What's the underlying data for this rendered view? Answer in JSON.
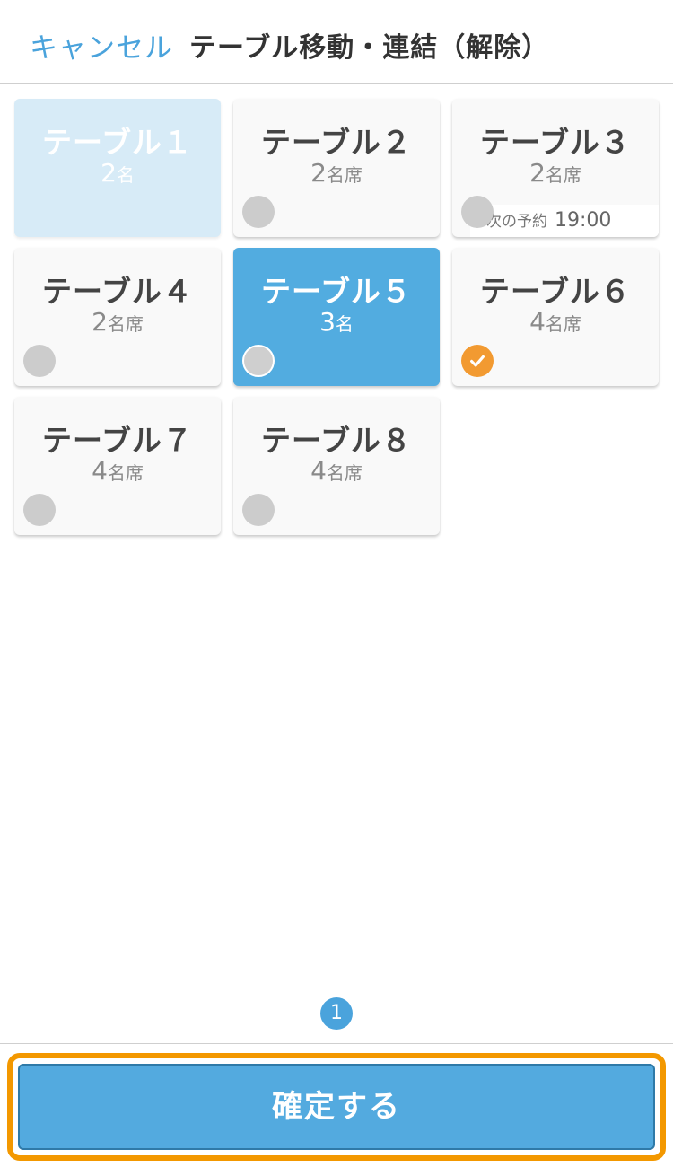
{
  "header": {
    "cancel_label": "キャンセル",
    "title": "テーブル移動・連結（解除）"
  },
  "tables": [
    {
      "name": "テーブル１",
      "seats_num": "2",
      "seats_unit": "名",
      "state": "disabled"
    },
    {
      "name": "テーブル２",
      "seats_num": "2",
      "seats_unit": "名席",
      "state": "available"
    },
    {
      "name": "テーブル３",
      "seats_num": "2",
      "seats_unit": "名席",
      "state": "available",
      "next_reservation_label": "次の予約",
      "next_reservation_time": "19:00"
    },
    {
      "name": "テーブル４",
      "seats_num": "2",
      "seats_unit": "名席",
      "state": "available"
    },
    {
      "name": "テーブル５",
      "seats_num": "3",
      "seats_unit": "名",
      "state": "current"
    },
    {
      "name": "テーブル６",
      "seats_num": "4",
      "seats_unit": "名席",
      "state": "checked"
    },
    {
      "name": "テーブル７",
      "seats_num": "4",
      "seats_unit": "名席",
      "state": "available"
    },
    {
      "name": "テーブル８",
      "seats_num": "4",
      "seats_unit": "名席",
      "state": "available"
    }
  ],
  "pagination": {
    "current_page": "1"
  },
  "footer": {
    "confirm_label": "確定する"
  },
  "colors": {
    "accent": "#4aa3dc",
    "selected_card": "#52ace0",
    "disabled_card": "#d7ebf7",
    "check": "#f29a31",
    "highlight_border": "#f39800"
  },
  "icons": {
    "checked": "checkmark-icon",
    "unchecked": "radio-circle-icon"
  }
}
